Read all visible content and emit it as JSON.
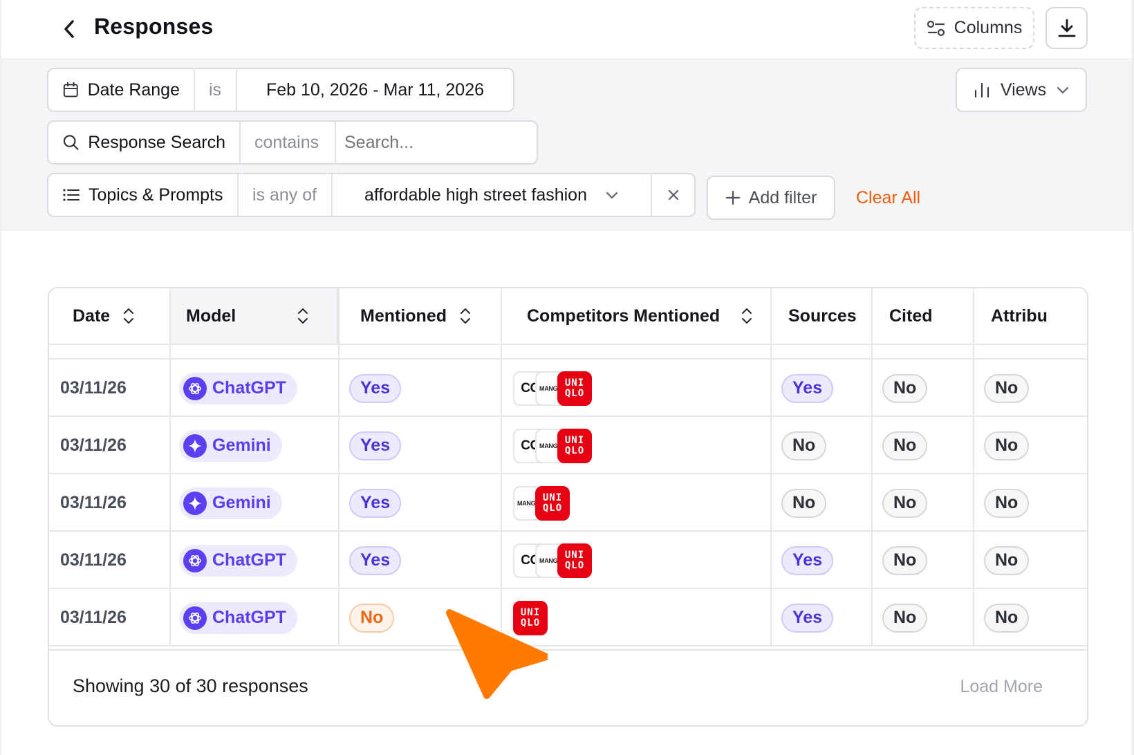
{
  "header": {
    "title": "Responses",
    "columns_label": "Columns"
  },
  "filters": {
    "date": {
      "field": "Date Range",
      "op": "is",
      "value": "Feb 10, 2026 - Mar 11, 2026"
    },
    "search": {
      "field": "Response Search",
      "op": "contains",
      "placeholder": "Search..."
    },
    "topics": {
      "field": "Topics & Prompts",
      "op": "is any of",
      "value": "affordable high street fashion"
    },
    "views_label": "Views",
    "add_filter_label": "Add filter",
    "clear_all_label": "Clear All"
  },
  "table": {
    "columns": [
      "Date",
      "Model",
      "Mentioned",
      "Competitors Mentioned",
      "Sources",
      "Cited",
      "Attribu"
    ],
    "logo_text": {
      "cos": "CO",
      "mango": "MANGO",
      "uniqlo_top": "UNI",
      "uniqlo_bottom": "QLO"
    },
    "rows": [
      {
        "date": "03/11/26",
        "model": "ChatGPT",
        "mentioned": "Yes",
        "competitors": [
          "cos",
          "mango",
          "uniqlo"
        ],
        "sources": "Yes",
        "cited": "No",
        "attributed": "No"
      },
      {
        "date": "03/11/26",
        "model": "Gemini",
        "mentioned": "Yes",
        "competitors": [
          "cos",
          "mango",
          "uniqlo"
        ],
        "sources": "No",
        "cited": "No",
        "attributed": "No"
      },
      {
        "date": "03/11/26",
        "model": "Gemini",
        "mentioned": "Yes",
        "competitors": [
          "mango",
          "uniqlo"
        ],
        "sources": "No",
        "cited": "No",
        "attributed": "No"
      },
      {
        "date": "03/11/26",
        "model": "ChatGPT",
        "mentioned": "Yes",
        "competitors": [
          "cos",
          "mango",
          "uniqlo"
        ],
        "sources": "Yes",
        "cited": "No",
        "attributed": "No"
      },
      {
        "date": "03/11/26",
        "model": "ChatGPT",
        "mentioned": "No",
        "competitors": [
          "uniqlo"
        ],
        "sources": "Yes",
        "cited": "No",
        "attributed": "No"
      }
    ],
    "footer": {
      "showing": "Showing 30 of 30 responses",
      "load_more": "Load More"
    }
  },
  "colors": {
    "accent": "#5b3ff2",
    "orange": "#f25a0c",
    "cursor": "#ff7a00"
  }
}
